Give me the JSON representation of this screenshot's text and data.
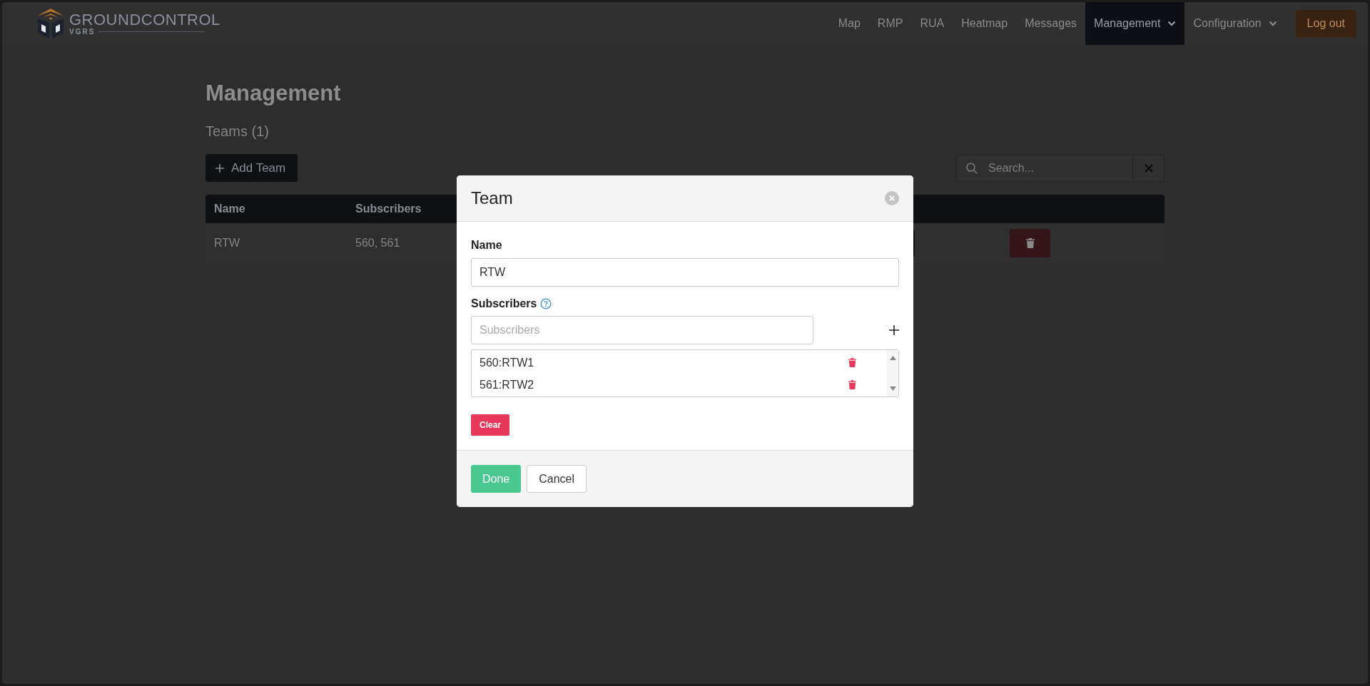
{
  "header": {
    "logo": {
      "wordmark": "**GROUND**CONTROL",
      "tagline": "VGRS"
    },
    "nav": [
      {
        "label": "Map",
        "selected": false,
        "dropdown": false
      },
      {
        "label": "RMP",
        "selected": false,
        "dropdown": false
      },
      {
        "label": "RUA",
        "selected": false,
        "dropdown": false
      },
      {
        "label": "Heatmap",
        "selected": false,
        "dropdown": false
      },
      {
        "label": "Messages",
        "selected": false,
        "dropdown": false
      },
      {
        "label": "Management",
        "selected": true,
        "dropdown": true
      },
      {
        "label": "Configuration",
        "selected": false,
        "dropdown": true
      }
    ],
    "logout": "Log out"
  },
  "page": {
    "title": "Management",
    "subtitle": "Teams (1)",
    "add_button": "Add Team",
    "search": {
      "placeholder": "Search..."
    }
  },
  "table": {
    "columns": [
      "Name",
      "Subscribers"
    ],
    "rows": [
      {
        "cells": [
          "RTW",
          "560, 561"
        ]
      }
    ]
  },
  "modal": {
    "title": "Team",
    "name_label": "Name",
    "name_value": "RTW",
    "subscribers_label": "Subscribers",
    "subscribers_placeholder": "Subscribers",
    "subscribers": [
      "560:RTW1",
      "561:RTW2"
    ],
    "clear": "Clear",
    "done": "Done",
    "cancel": "Cancel"
  }
}
